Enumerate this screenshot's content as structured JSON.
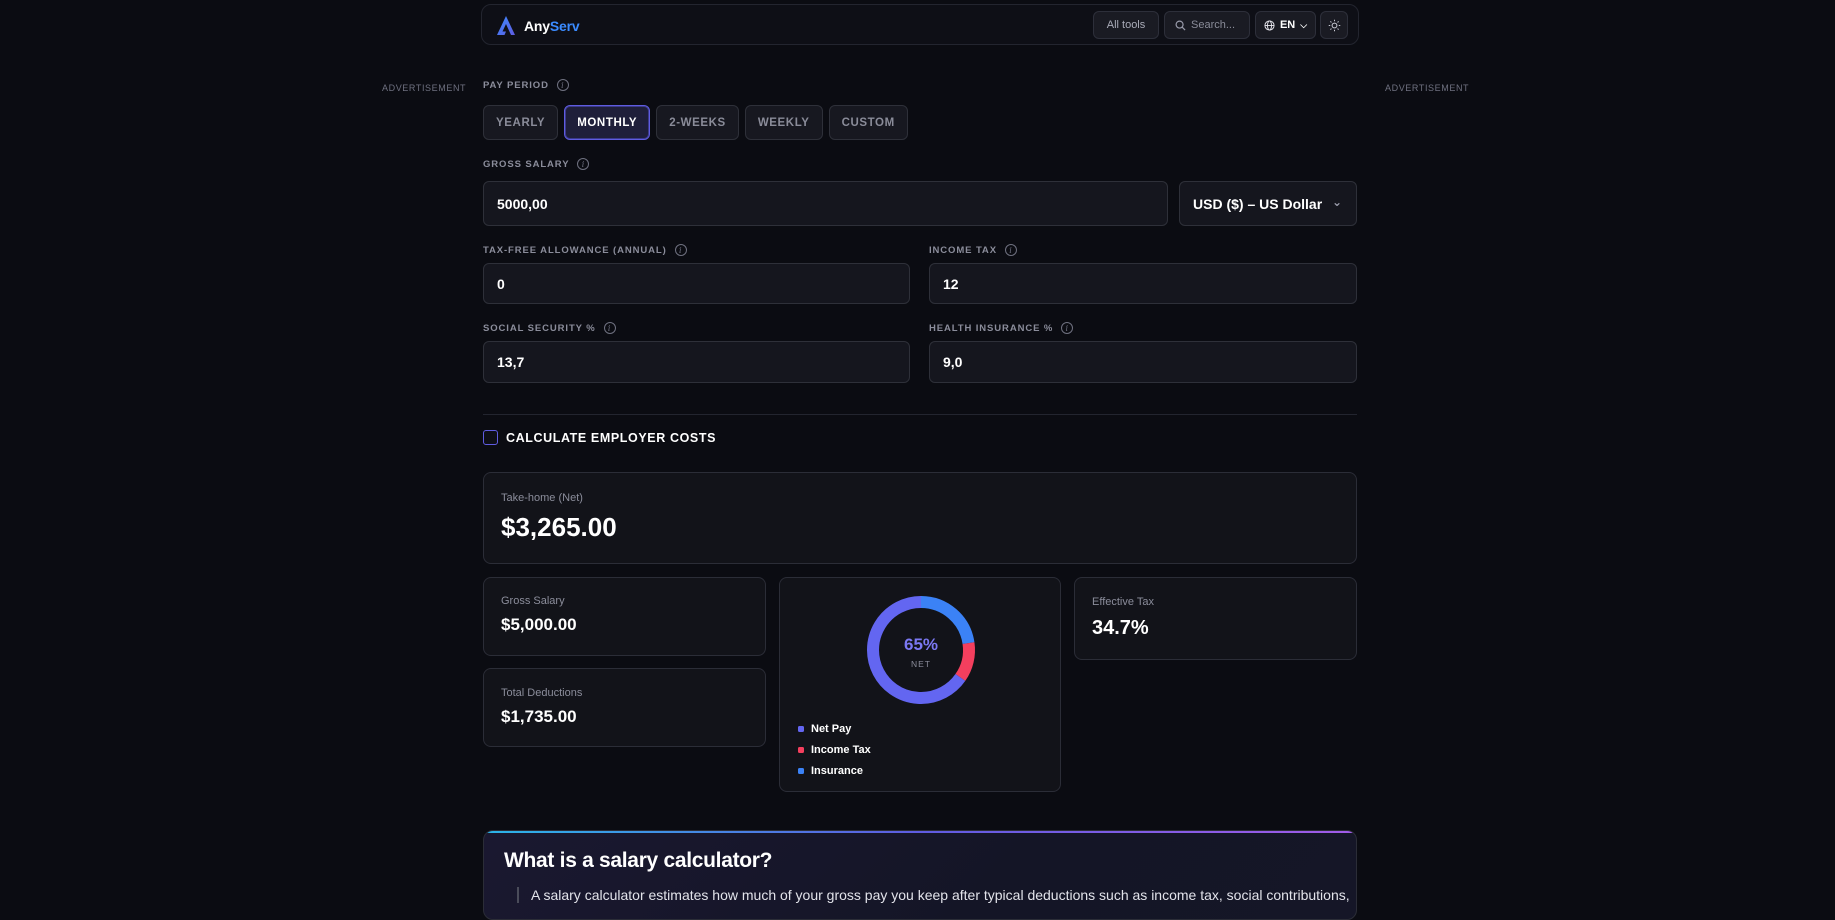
{
  "header": {
    "brand_any": "Any",
    "brand_serv": "Serv",
    "all_tools": "All tools",
    "search_placeholder": "Search...",
    "language": "EN"
  },
  "ads": {
    "left": "ADVERTISEMENT",
    "right": "ADVERTISEMENT"
  },
  "form": {
    "pay_period_label": "PAY PERIOD",
    "pay_periods": [
      "YEARLY",
      "MONTHLY",
      "2-WEEKS",
      "WEEKLY",
      "CUSTOM"
    ],
    "selected_period": "MONTHLY",
    "gross_salary_label": "GROSS SALARY",
    "gross_salary_value": "5000,00",
    "currency_value": "USD ($) – US Dollar",
    "tax_free_label": "TAX-FREE ALLOWANCE (ANNUAL)",
    "tax_free_value": "0",
    "income_tax_label": "INCOME TAX",
    "income_tax_value": "12",
    "social_security_label": "SOCIAL SECURITY %",
    "social_security_value": "13,7",
    "health_insurance_label": "HEALTH INSURANCE %",
    "health_insurance_value": "9,0",
    "employer_costs_label": "CALCULATE EMPLOYER COSTS",
    "employer_costs_checked": false
  },
  "results": {
    "net_caption": "Take-home (Net)",
    "net_value": "$3,265.00",
    "gross_caption": "Gross Salary",
    "gross_value": "$5,000.00",
    "deductions_caption": "Total Deductions",
    "deductions_value": "$1,735.00",
    "effective_caption": "Effective Tax",
    "effective_value": "34.7%",
    "donut_percent": "65%",
    "donut_sub": "NET"
  },
  "chart_data": {
    "type": "pie",
    "categories": [
      "Net Pay",
      "Income Tax",
      "Insurance"
    ],
    "values": [
      3265,
      600,
      1135
    ],
    "colors": [
      "#6366f1",
      "#f43f5e",
      "#3b82f6"
    ]
  },
  "info": {
    "title": "What is a salary calculator?",
    "text": "A salary calculator estimates how much of your gross pay you keep after typical deductions such as income tax, social contributions,"
  },
  "colors": {
    "accent": "#5f5ce0",
    "brand_blue": "#3b8bff",
    "background": "#0b0c12"
  }
}
